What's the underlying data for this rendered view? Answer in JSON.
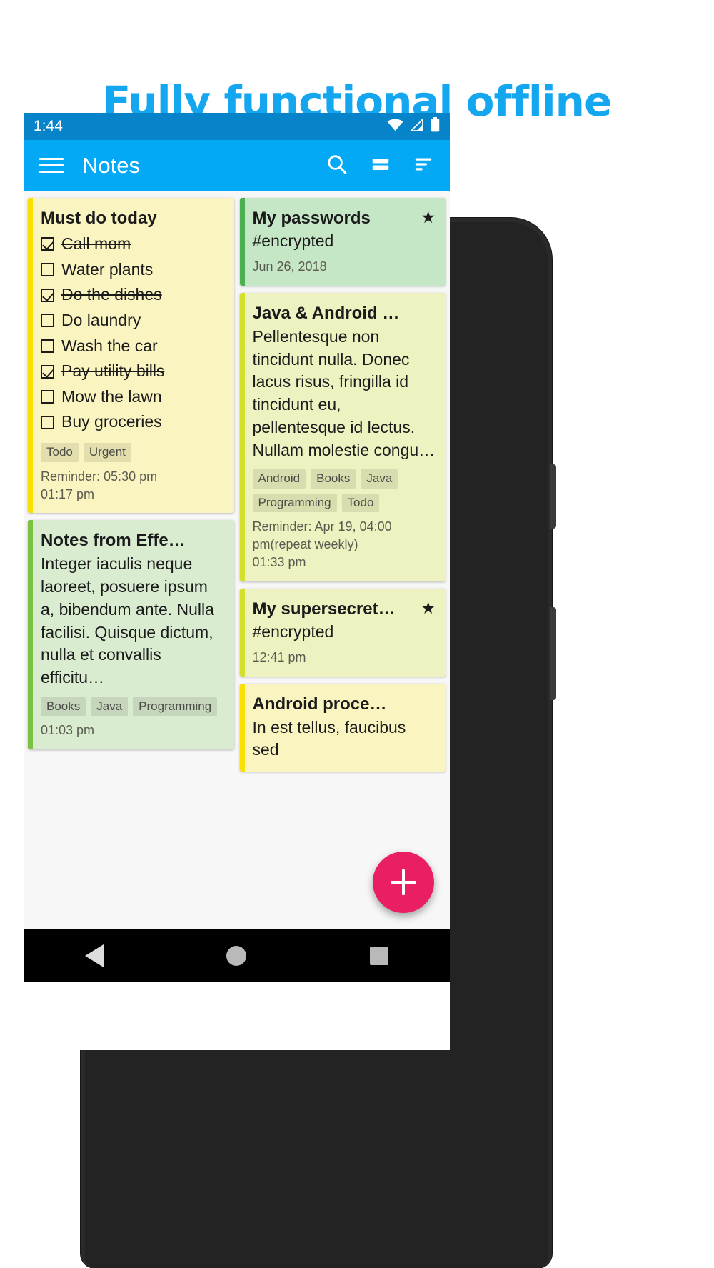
{
  "headline": "Fully functional offline",
  "phone": {
    "status_bar": {
      "clock": "1:44",
      "icons": [
        "wifi-icon",
        "signal-icon",
        "battery-icon"
      ],
      "bg": "#0783c9"
    },
    "app_bar": {
      "menu_icon": "hamburger-menu-icon",
      "title": "Notes",
      "actions": [
        "search-icon",
        "layout-view-icon",
        "sort-icon"
      ],
      "bg": "#03a9f4"
    },
    "nav_bar": {
      "back": "back-triangle-icon",
      "home": "home-circle-icon",
      "recents": "recents-square-icon"
    },
    "fab": {
      "label": "+",
      "name": "add-note-fab",
      "color": "#e91e63"
    }
  },
  "notes": {
    "left": [
      {
        "id": "must-do-today",
        "title": "Must do today",
        "bg": "#faf4c0",
        "stripe": "#f9e000",
        "checklist": [
          {
            "text": "Call mom",
            "checked": true
          },
          {
            "text": "Water plants",
            "checked": false
          },
          {
            "text": "Do the dishes",
            "checked": true
          },
          {
            "text": "Do laundry",
            "checked": false
          },
          {
            "text": "Wash the car",
            "checked": false
          },
          {
            "text": "Pay utility bills",
            "checked": true
          },
          {
            "text": "Mow the lawn",
            "checked": false
          },
          {
            "text": "Buy groceries",
            "checked": false
          }
        ],
        "tags": [
          "Todo",
          "Urgent"
        ],
        "reminder": "Reminder: 05:30 pm",
        "time": "01:17 pm",
        "starred": false
      },
      {
        "id": "notes-from-effective-java",
        "title": "Notes from Effe…",
        "bg": "#d9ecd0",
        "stripe": "#7cc242",
        "body": "Integer iaculis neque laoreet, posuere ipsum a, bibendum ante. Nulla facilisi. Quisque dictum, nulla et convallis efficitu…",
        "tags": [
          "Books",
          "Java",
          "Programming"
        ],
        "time": "01:03 pm",
        "starred": false
      }
    ],
    "right": [
      {
        "id": "my-passwords",
        "title": "My passwords",
        "bg": "#c6e7c6",
        "stripe": "#4caf50",
        "sub": "#encrypted",
        "time": "Jun 26, 2018",
        "starred": true
      },
      {
        "id": "java-and-android",
        "title": "Java & Android …",
        "bg": "#eef2c0",
        "stripe": "#d4e02a",
        "body": "Pellentesque non tincidunt nulla. Donec lacus risus, fringilla id tincidunt eu, pellentesque id lectus. Nullam molestie congu…",
        "tags": [
          "Android",
          "Books",
          "Java",
          "Programming",
          "Todo"
        ],
        "reminder": "Reminder: Apr 19, 04:00 pm(repeat weekly)",
        "time": "01:33 pm",
        "starred": false
      },
      {
        "id": "my-supersecret",
        "title": "My supersecret…",
        "bg": "#eef2c0",
        "stripe": "#d4e02a",
        "sub": "#encrypted",
        "time": "12:41 pm",
        "starred": true
      },
      {
        "id": "android-process",
        "title": "Android proce…",
        "bg": "#faf4c0",
        "stripe": "#f9e000",
        "body": "In est tellus, faucibus sed",
        "starred": false
      }
    ]
  },
  "star_glyph": "★"
}
